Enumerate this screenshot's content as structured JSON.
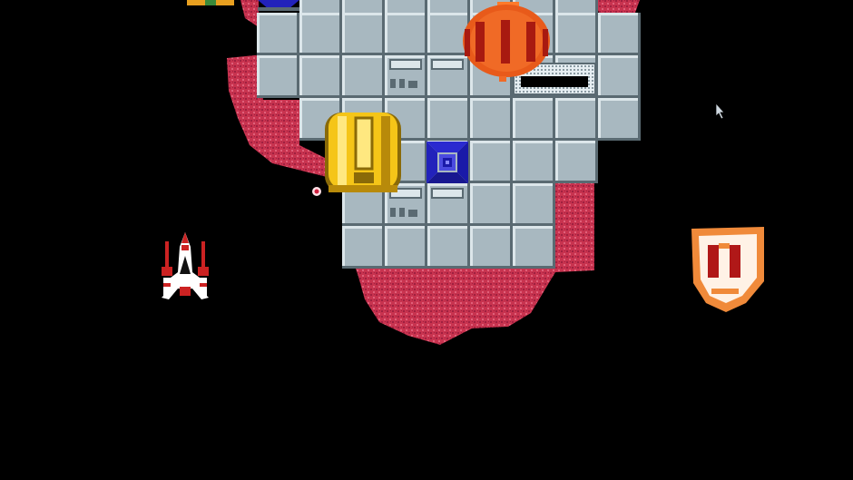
{
  "game": {
    "title": "",
    "colors": {
      "space": "#000000",
      "terrain": "#c8334f",
      "terrain_dark": "#a02040",
      "tile": "#a8b8c0",
      "tile_light": "#dce6ea",
      "tile_dark": "#5a6a72",
      "player_red": "#cc2222",
      "player_white": "#ffffff",
      "enemy_orange": "#e85a1a",
      "enemy_gold": "#f5c518",
      "shield_orange": "#f08a3a",
      "vent_blue": "#2222bb"
    },
    "sprites": [
      {
        "name": "player-ship",
        "kind": "player"
      },
      {
        "name": "orange-dome-turret",
        "kind": "enemy"
      },
      {
        "name": "gold-capsule-enemy",
        "kind": "enemy"
      },
      {
        "name": "shield-powerup",
        "kind": "powerup"
      },
      {
        "name": "blue-vent-hatch",
        "kind": "ground-target"
      },
      {
        "name": "enemy-bullet",
        "kind": "projectile"
      },
      {
        "name": "mouse-cursor",
        "kind": "cursor"
      }
    ]
  }
}
